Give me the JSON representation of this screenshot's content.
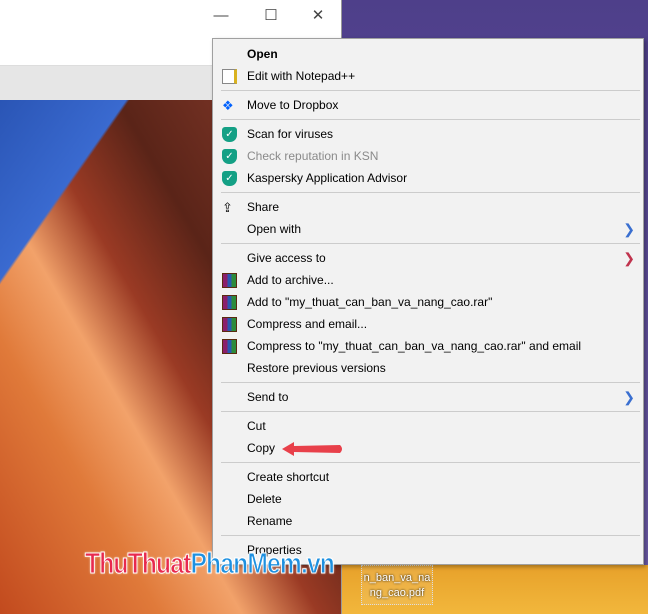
{
  "window": {
    "minimize": "—",
    "maximize": "☐",
    "close": "✕"
  },
  "menu": {
    "groups": [
      [
        {
          "label": "Open",
          "bold": true,
          "icon": ""
        },
        {
          "label": "Edit with Notepad++",
          "icon": "notepad-icon"
        }
      ],
      [
        {
          "label": "Move to Dropbox",
          "icon": "dropbox-icon"
        }
      ],
      [
        {
          "label": "Scan for viruses",
          "icon": "kaspersky-shield-icon"
        },
        {
          "label": "Check reputation in KSN",
          "icon": "kaspersky-shield-icon",
          "disabled": true
        },
        {
          "label": "Kaspersky Application Advisor",
          "icon": "kaspersky-shield-icon"
        }
      ],
      [
        {
          "label": "Share",
          "icon": "share-icon"
        },
        {
          "label": "Open with",
          "submenu": true
        }
      ],
      [
        {
          "label": "Give access to",
          "submenu": true,
          "chevron_color": "red"
        },
        {
          "label": "Add to archive...",
          "icon": "winrar-icon"
        },
        {
          "label": "Add to \"my_thuat_can_ban_va_nang_cao.rar\"",
          "icon": "winrar-icon"
        },
        {
          "label": "Compress and email...",
          "icon": "winrar-icon"
        },
        {
          "label": "Compress to \"my_thuat_can_ban_va_nang_cao.rar\" and email",
          "icon": "winrar-icon"
        },
        {
          "label": "Restore previous versions"
        }
      ],
      [
        {
          "label": "Send to",
          "submenu": true
        }
      ],
      [
        {
          "label": "Cut"
        },
        {
          "label": "Copy"
        }
      ],
      [
        {
          "label": "Create shortcut"
        },
        {
          "label": "Delete"
        },
        {
          "label": "Rename"
        }
      ],
      [
        {
          "label": "Properties"
        }
      ]
    ]
  },
  "desktop_file": {
    "line1": "n_ban_va_na",
    "line2": "ng_cao.pdf"
  },
  "watermark": {
    "part1": "ThuThuat",
    "part2": "PhanMem",
    "part3": ".vn"
  },
  "colors": {
    "accent": "#3a6fd0",
    "arrow": "#e8404a",
    "wm_red": "#e8294e",
    "wm_blue": "#1e90e0"
  }
}
